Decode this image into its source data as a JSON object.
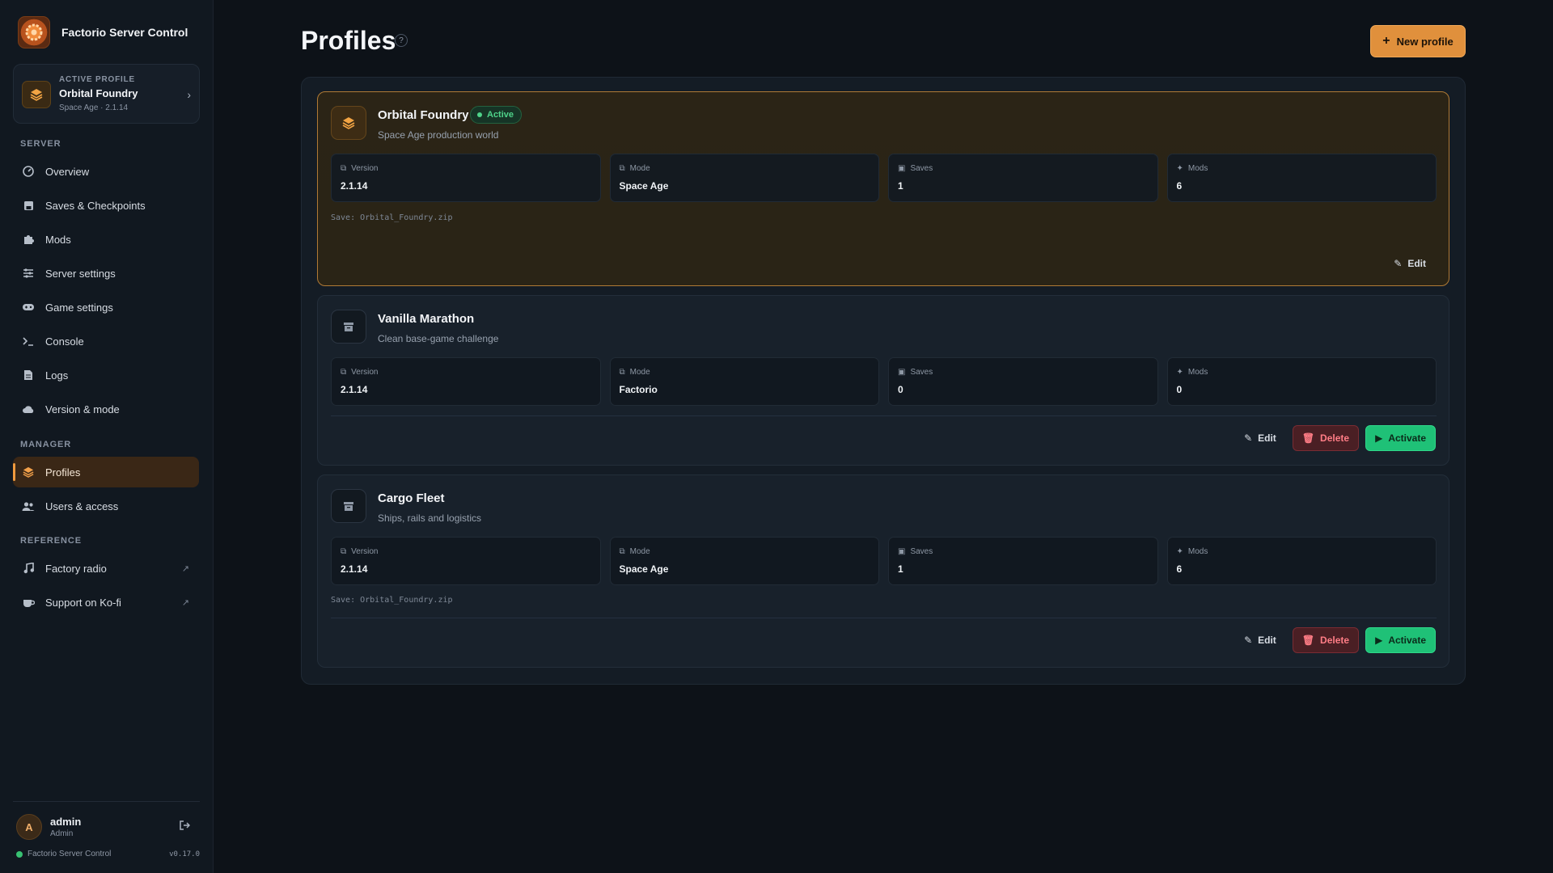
{
  "app": {
    "title": "Factorio Server Control",
    "version": "v0.17.0",
    "status_text": "Factorio Server Control"
  },
  "active_profile": {
    "kicker": "ACTIVE PROFILE",
    "name": "Orbital Foundry",
    "sub": "Space Age · 2.1.14"
  },
  "nav": {
    "server_title": "SERVER",
    "server": [
      {
        "label": "Overview",
        "icon": "gauge-icon"
      },
      {
        "label": "Saves & Checkpoints",
        "icon": "floppy-icon"
      },
      {
        "label": "Mods",
        "icon": "puzzle-icon"
      },
      {
        "label": "Server settings",
        "icon": "sliders-icon"
      },
      {
        "label": "Game settings",
        "icon": "gamepad-icon"
      },
      {
        "label": "Console",
        "icon": "terminal-icon"
      },
      {
        "label": "Logs",
        "icon": "file-icon"
      },
      {
        "label": "Version & mode",
        "icon": "cloud-icon"
      }
    ],
    "manager_title": "MANAGER",
    "manager": [
      {
        "label": "Profiles",
        "icon": "layers-icon",
        "active": true
      },
      {
        "label": "Users & access",
        "icon": "users-icon"
      }
    ],
    "reference_title": "REFERENCE",
    "reference": [
      {
        "label": "Factory radio",
        "icon": "music-icon",
        "external": "↗"
      },
      {
        "label": "Support on Ko-fi",
        "icon": "coffee-icon",
        "external": "↗"
      }
    ]
  },
  "user": {
    "initial": "A",
    "name": "admin",
    "role": "Admin"
  },
  "page": {
    "title": "Profiles",
    "help": "?",
    "new_button": "New profile"
  },
  "stat_labels": {
    "version": "Version",
    "mode": "Mode",
    "saves": "Saves",
    "mods": "Mods"
  },
  "buttons": {
    "edit": "Edit",
    "delete": "Delete",
    "activate": "Activate"
  },
  "profiles": [
    {
      "name": "Orbital Foundry",
      "badge": "Active",
      "description": "Space Age production world",
      "version": "2.1.14",
      "mode": "Space Age",
      "saves": "1",
      "mods": "6",
      "save_note": "Save: Orbital_Foundry.zip"
    },
    {
      "name": "Vanilla Marathon",
      "description": "Clean base-game challenge",
      "version": "2.1.14",
      "mode": "Factorio",
      "saves": "0",
      "mods": "0"
    },
    {
      "name": "Cargo Fleet",
      "description": "Ships, rails and logistics",
      "version": "2.1.14",
      "mode": "Space Age",
      "saves": "1",
      "mods": "6",
      "save_note": "Save: Orbital_Foundry.zip"
    }
  ],
  "colors": {
    "accent": "#e0903c",
    "active_green": "#4fd38a",
    "danger": "#ff7d86",
    "bg": "#0d1218"
  }
}
